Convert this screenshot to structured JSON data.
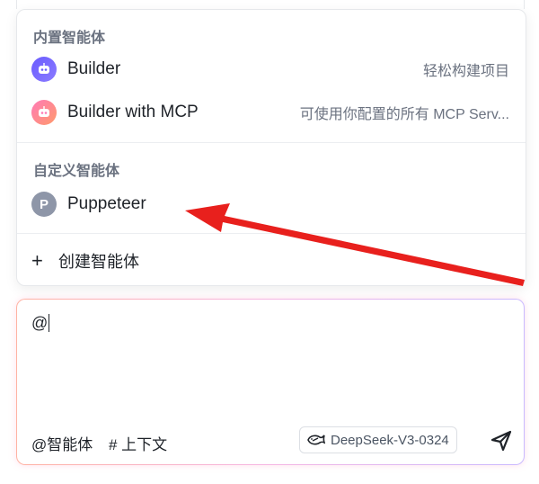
{
  "builtin_section": {
    "title": "内置智能体",
    "items": [
      {
        "name": "Builder",
        "desc": "轻松构建项目"
      },
      {
        "name": "Builder with MCP",
        "desc": "可使用你配置的所有 MCP Serv..."
      }
    ]
  },
  "custom_section": {
    "title": "自定义智能体",
    "items": [
      {
        "name": "Puppeteer",
        "avatar_letter": "P"
      }
    ]
  },
  "create_agent": {
    "plus": "+",
    "label": "创建智能体"
  },
  "composer": {
    "input_value": "@",
    "agent_button": "@智能体",
    "context_button": "# 上下文",
    "model_name": "DeepSeek-V3-0324"
  },
  "colors": {
    "arrow": "#e8201d",
    "builder_avatar": "#6a5cff",
    "mcp_avatar": "#ff7ab6",
    "custom_avatar": "#8e96a8"
  },
  "icons": {
    "builder": "robot-icon",
    "mcp": "robot-icon",
    "model": "whale-icon",
    "send": "paper-plane-icon"
  }
}
